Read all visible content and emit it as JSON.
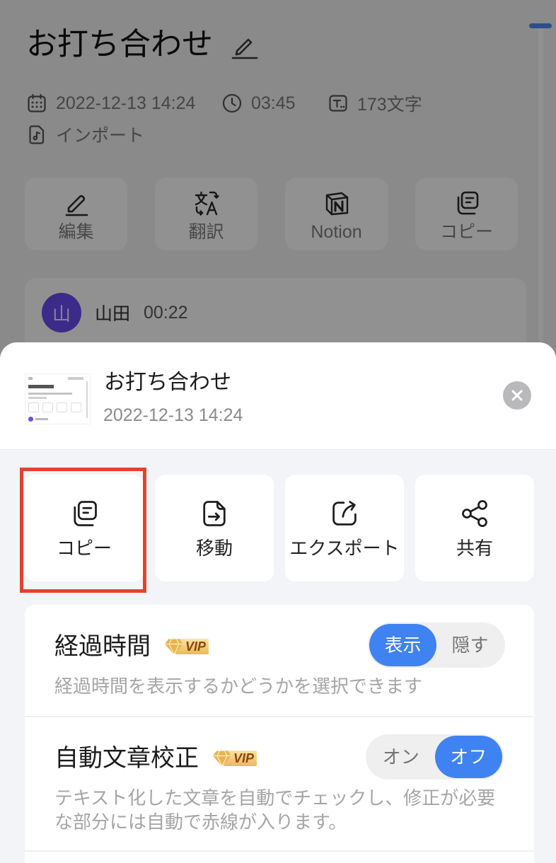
{
  "background": {
    "title": "お打ち合わせ",
    "title_icon": "pencil-icon",
    "meta": {
      "date": "2022-12-13 14:24",
      "date_icon": "calendar-icon",
      "duration": "03:45",
      "duration_icon": "clock-icon",
      "char_count": "173文字",
      "char_count_icon": "text-count-icon",
      "source": "インポート",
      "source_icon": "audio-file-icon"
    },
    "actions": [
      {
        "label": "編集",
        "icon": "pencil-icon"
      },
      {
        "label": "翻訳",
        "icon": "translate-icon"
      },
      {
        "label": "Notion",
        "icon": "notion-icon"
      },
      {
        "label": "コピー",
        "icon": "copy-icon"
      }
    ],
    "transcript": {
      "avatar_initial": "山",
      "speaker": "山田",
      "timestamp": "00:22"
    }
  },
  "sheet": {
    "title": "お打ち合わせ",
    "date": "2022-12-13 14:24",
    "close_icon": "close-icon",
    "actions": [
      {
        "label": "コピー",
        "icon": "copy-icon",
        "highlighted": true
      },
      {
        "label": "移動",
        "icon": "move-icon",
        "highlighted": false
      },
      {
        "label": "エクスポート",
        "icon": "export-icon",
        "highlighted": false
      },
      {
        "label": "共有",
        "icon": "share-icon",
        "highlighted": false
      }
    ],
    "settings": [
      {
        "title": "経過時間",
        "badge": "VIP",
        "description": "経過時間を表示するかどうかを選択できます",
        "options": [
          "表示",
          "隠す"
        ],
        "selected_index": 0
      },
      {
        "title": "自動文章校正",
        "badge": "VIP",
        "description": "テキスト化した文章を自動でチェックし、修正が必要な部分には自動で赤線が入ります。",
        "options": [
          "オン",
          "オフ"
        ],
        "selected_index": 1
      }
    ]
  },
  "colors": {
    "accent": "#3f82f1",
    "highlight": "#e2432f",
    "avatar": "#6a4cf0",
    "vip_gold": "#e9b24e",
    "scrollbar_thumb": "#4a8cf5"
  }
}
